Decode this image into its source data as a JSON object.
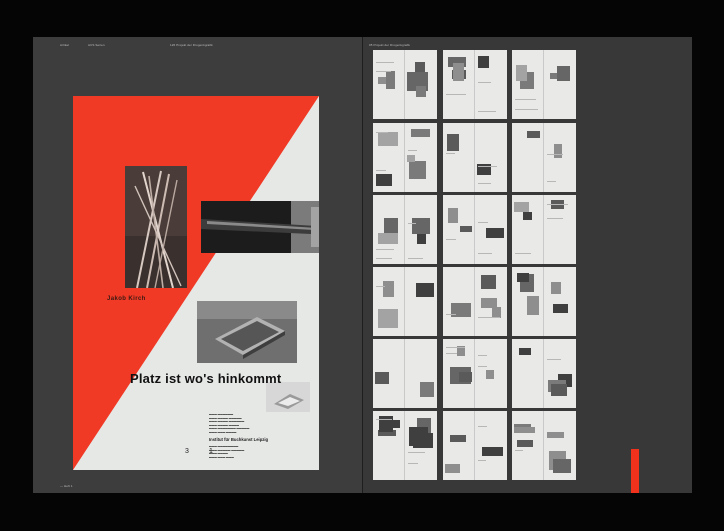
{
  "left_page": {
    "header": {
      "col1": "Artikel",
      "col2": "ACS Serien",
      "col3": "126 Projekt der Drogenkgrafik"
    },
    "footer": "— Heft 1"
  },
  "poster": {
    "author": "Jakob Kirch",
    "title": "Platz ist wo's hinkommt",
    "institution": "Institut für Buchkunst Leipzig",
    "number_left": "3",
    "number_right": "1",
    "colors": {
      "red": "#f03a26",
      "paper": "#e6e8e6"
    }
  },
  "right_page": {
    "header": "05 Projekt der Drogenkgrafik",
    "accent_color": "#f0321c"
  }
}
